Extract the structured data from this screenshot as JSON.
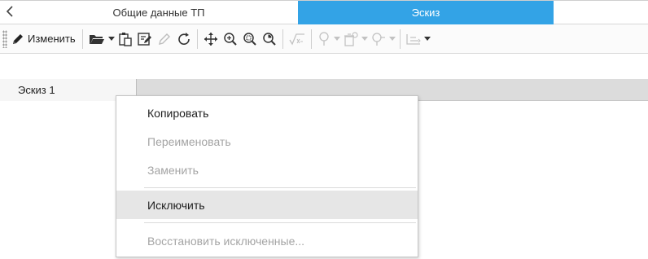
{
  "tabs": {
    "back_icon": "chevron-left-icon",
    "general": "Общие данные ТП",
    "sketch": "Эскиз",
    "active_color": "#33a3e6"
  },
  "toolbar": {
    "edit_label": "Изменить",
    "icons": [
      "pencil-icon",
      "folder-open-icon",
      "paste-icon",
      "edit-document-icon",
      "brush-icon",
      "refresh-icon",
      "move-icon",
      "zoom-in-icon",
      "zoom-window-icon",
      "zoom-fit-icon",
      "check-formula-icon",
      "probe-icon",
      "delete-tool-icon",
      "tool-icon",
      "layout-icon"
    ]
  },
  "sheet": {
    "tab_label": "Эскиз 1"
  },
  "context_menu": {
    "items": [
      {
        "label": "Копировать",
        "enabled": true
      },
      {
        "label": "Переименовать",
        "enabled": false
      },
      {
        "label": "Заменить",
        "enabled": false
      },
      {
        "label": "Исключить",
        "enabled": true,
        "highlighted": true
      },
      {
        "label": "Восстановить исключенные...",
        "enabled": false
      }
    ]
  }
}
